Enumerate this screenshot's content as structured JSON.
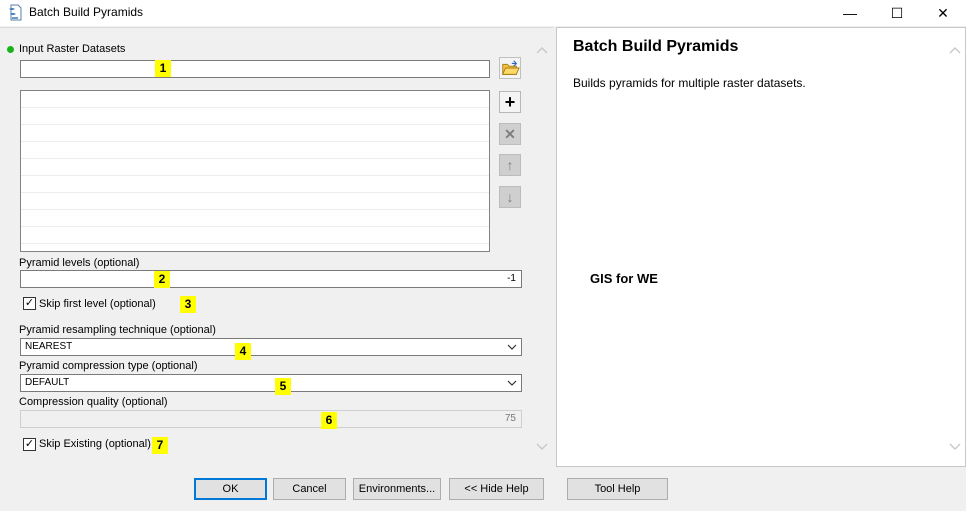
{
  "window": {
    "title": "Batch Build Pyramids",
    "minimize": "—",
    "maximize": "☐",
    "close": "✕"
  },
  "form": {
    "input_label": "Input Raster Datasets",
    "input_value": "",
    "pyramid_levels_label": "Pyramid levels (optional)",
    "pyramid_levels_value": "-1",
    "skip_first_label": "Skip first level (optional)",
    "skip_first_checked": "✓",
    "resampling_label": "Pyramid resampling technique (optional)",
    "resampling_value": "NEAREST",
    "compression_type_label": "Pyramid compression type (optional)",
    "compression_type_value": "DEFAULT",
    "compression_quality_label": "Compression quality (optional)",
    "compression_quality_value": "75",
    "skip_existing_label": "Skip Existing (optional)",
    "skip_existing_checked": "✓"
  },
  "list_buttons": {
    "add": "+",
    "remove": "✕",
    "up": "↑",
    "down": "↓"
  },
  "markers": [
    "1",
    "2",
    "3",
    "4",
    "5",
    "6",
    "7"
  ],
  "help": {
    "title": "Batch Build Pyramids",
    "description": "Builds pyramids for multiple raster datasets.",
    "watermark": "GIS for WE"
  },
  "buttons": {
    "ok": "OK",
    "cancel": "Cancel",
    "environments": "Environments...",
    "hide_help": "<< Hide Help",
    "tool_help": "Tool Help"
  },
  "icons": {
    "app": "toolbox-script-icon",
    "folder": "open-folder-icon"
  },
  "colors": {
    "required_dot": "#1bb31b",
    "marker_bg": "#ffff00",
    "default_button_border": "#0078d7"
  }
}
